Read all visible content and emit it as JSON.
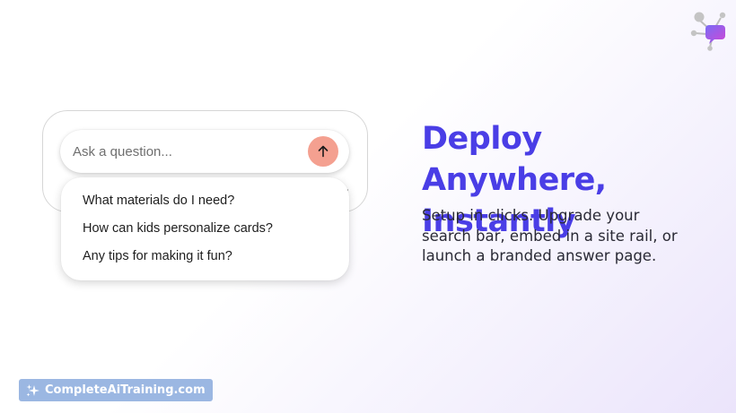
{
  "widget": {
    "search_placeholder": "Ask a question...",
    "suggestions": [
      "What materials do I need?",
      "How can kids personalize cards?",
      "Any tips for making it fun?"
    ]
  },
  "hero": {
    "headline_line1": "Deploy Anywhere,",
    "headline_line2": "Instantly",
    "subtext": "Setup in clicks. Upgrade your search bar, embed in a site rail, or launch a branded answer page."
  },
  "brand": {
    "name": "CompleteAiTraining.com"
  },
  "colors": {
    "headline": "#4a3ee6",
    "send_button": "#f4a090",
    "brand_badge": "#9bb7e2"
  },
  "icons": {
    "send": "arrow-up-icon",
    "logo": "network-chat-logo-icon",
    "brand": "sparkle-icon"
  }
}
